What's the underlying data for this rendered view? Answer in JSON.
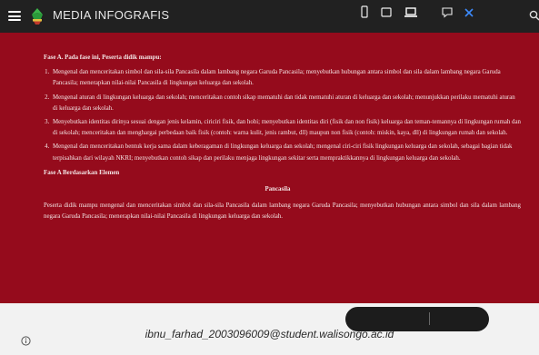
{
  "header": {
    "title": "MEDIA INFOGRAFIS",
    "menu_icon": "hamburger-icon",
    "logo_icon": "green-emblem-logo",
    "search_icon": "search-icon"
  },
  "content": {
    "heading": "Fase A. Pada fase ini, Peserta didik mampu:",
    "items": [
      "Mengenal dan menceritakan simbol dan sila-sila Pancasila dalam lambang negara Garuda Pancasila; menyebutkan hubungan antara simbol dan sila dalam lambang negara Garuda Pancasila; menerapkan nilai-nilai Pancasila di lingkungan keluarga dan sekolah.",
      "Mengenal aturan di lingkungan keluarga dan sekolah; menceritakan contoh sikap mematuhi dan tidak mematuhi aturan di keluarga dan sekolah; menunjukkan perilaku mematuhi aturan di keluarga dan sekolah.",
      "Menyebutkan identitas dirinya sesuai dengan jenis kelamin, ciriciri fisik, dan hobi; menyebutkan identitas diri (fisik dan non fisik) keluarga dan teman-temannya di lingkungan rumah dan di sekolah; menceritakan dan menghargai perbedaan baik fisik (contoh: warna kulit, jenis rambut, dll) maupun non fisik (contoh: miskin, kaya, dll) di lingkungan rumah dan sekolah.",
      "Mengenal dan menceritakan bentuk kerja sama dalam keberagaman di lingkungan keluarga dan sekolah; mengenal ciri-ciri fisik lingkungan keluarga dan sekolah, sebagai bagian tidak terpisahkan dari wilayah NKRI; menyebutkan contoh sikap dan perilaku menjaga lingkungan sekitar serta mempraktikkannya di lingkungan keluarga dan sekolah."
    ],
    "heading2": "Fase A Berdasarkan Elemen",
    "element_title": "Pancasila",
    "element_text": "Peserta didik mampu mengenal dan menceritakan simbol dan sila-sila Pancasila dalam lambang negara Garuda Pancasila; menyebutkan hubungan antara simbol dan sila dalam lambang negara Garuda Pancasila; menerapkan nilai-nilai Pancasila di lingkungan keluarga dan sekolah."
  },
  "footer": {
    "email": "ibnu_farhad_2003096009@student.walisongo.ac.id",
    "info_icon": "info-icon"
  },
  "toolbar": {
    "buttons": [
      "phone-view-icon",
      "tablet-view-icon",
      "laptop-view-icon",
      "comment-icon",
      "close-icon"
    ]
  },
  "colors": {
    "header_bg": "#212121",
    "content_bg": "#950b1c",
    "page_bg": "#f2f2f2",
    "toolbar_accent": "#3d8bfd"
  }
}
